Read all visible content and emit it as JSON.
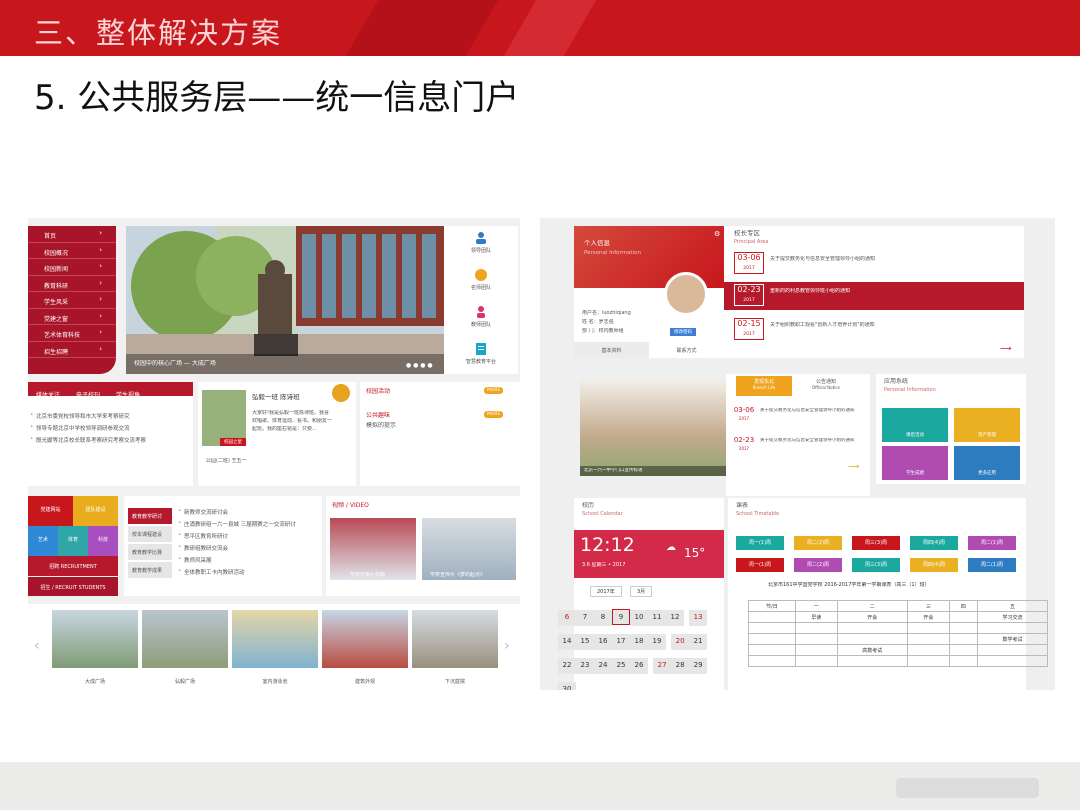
{
  "slide": {
    "header": "三、整体解决方案",
    "title": "5. 公共服务层——统一信息门户"
  },
  "left": {
    "menu": [
      "首页",
      "校园概况",
      "校园新闻",
      "教育科研",
      "学生风采",
      "党建之窗",
      "艺术体育科技",
      "招生招聘"
    ],
    "photo_caption": "校园中的核心广场 — 大成广场",
    "icons": [
      {
        "label": "领导团队",
        "icon": "people-icon"
      },
      {
        "label": "名师团队",
        "icon": "teacher-icon"
      },
      {
        "label": "教师团队",
        "icon": "person-icon"
      },
      {
        "label": "智慧教育平台",
        "icon": "book-icon"
      }
    ],
    "news_tabs": [
      "媒体关注",
      "电子校刊",
      "学生视角"
    ],
    "news_items": [
      "北京市委党校领导和市大学来考察研究",
      "领导专题北京中学校领导调研参观交流",
      "殷光媛等北京校长联系考察研究考察交流考察"
    ],
    "profile": {
      "name": "弘毅一班 陈诗班",
      "bio": [
        "大家好!我是弘毅一班陈诗班。我喜",
        "欢唱歌、体育运动、看书。和朋友一",
        "起玩。我的座右铭是：只要..."
      ],
      "badge": "校园之星",
      "footer": "公园(二班) 王五一"
    },
    "notice_title": "校园活动",
    "notice_tags": [
      "MORE",
      "MORE"
    ],
    "notice_items": [
      "公共趣味",
      "模拟的提示"
    ],
    "tiles": [
      {
        "label": "党建网站",
        "color": "#c8161d"
      },
      {
        "label": "团队建设",
        "color": "#e9ac1d"
      },
      {
        "label": "艺术",
        "color": "#2f89d6"
      },
      {
        "label": "体育",
        "color": "#30a6a8"
      },
      {
        "label": "科技",
        "color": "#a84fbf"
      }
    ],
    "recruit": [
      "招聘 RECRUITMENT",
      "招生 / RECRUIT STUDENTS"
    ],
    "sub_tabs": [
      "教育教学研讨",
      "校本课程建设",
      "教育教学比赛",
      "教育教学成果"
    ],
    "sub_items": [
      "新教师交流研讨会",
      "庄涌教研组一六一县城 三届期赛之一交流研讨",
      "思平区教育所研讨",
      "教研组教研交流会",
      "教师风采展",
      "全体教职工卡内教研活动"
    ],
    "video_title": "视频 / VIDEO",
    "video_caps": [
      "学校形象片剪辑",
      "学校宣传片《梦的起点》"
    ],
    "gallery": [
      "大成广场",
      "弘毅广场",
      "室内游泳池",
      "建筑外观",
      "下沉庭院"
    ]
  },
  "right": {
    "personal": {
      "title": "个人信息",
      "subtitle": "Personal Information",
      "fields": [
        "用户名：luozhiqiang",
        "姓  名：罗志强",
        "部  门：校内教师组"
      ],
      "tag": "修改密码",
      "tabs": [
        "基本资料",
        "联系方式"
      ]
    },
    "principal": {
      "title": "校长专区",
      "subtitle": "Principal Area",
      "items": [
        {
          "date": "03-06",
          "year": "2017",
          "text": "关于提交教务化与信息安全管理领导小组的通知"
        },
        {
          "date": "02-23",
          "year": "2017",
          "text": "重新的的利息教管领导班小组的通知"
        },
        {
          "date": "02-15",
          "year": "2017",
          "text": "关于组织教职工观看\"创新人才培养计划\"的通知"
        }
      ]
    },
    "photo_caption": "北京一六一中学门口宣传标语",
    "notice": {
      "tabs": [
        {
          "top": "发现东北",
          "sub": "Branch Life"
        },
        {
          "top": "公告通知",
          "sub": "Official Notice"
        }
      ],
      "items": [
        {
          "date": "03-06",
          "year": "2017",
          "text": "关于提交教务化与信息安全管理领导小组的通知"
        },
        {
          "date": "02-23",
          "year": "2017",
          "text": "关于提交教务化与信息安全管理领导小组的通知"
        }
      ]
    },
    "apps": {
      "title": "应用系统",
      "subtitle": "Personal Information",
      "items": [
        {
          "label": "课后活动",
          "color": "#1aa89f"
        },
        {
          "label": "资产管理",
          "color": "#eab021"
        },
        {
          "label": "学生成绩",
          "color": "#b04cb1"
        },
        {
          "label": "更多应用",
          "color": "#2d7cc0"
        }
      ]
    },
    "calendar": {
      "title": "校历",
      "subtitle": "School Calendar",
      "time": "12:12",
      "date": "3.6  星期三 • 2017",
      "temp": "15°",
      "year": "2017年",
      "month": "3月",
      "days": [
        "6",
        "7",
        "8",
        "9",
        "10",
        "11",
        "12",
        "13",
        "14",
        "15",
        "16",
        "17",
        "18",
        "19",
        "20",
        "21",
        "22",
        "23",
        "24",
        "25",
        "26",
        "27",
        "28",
        "29",
        "30"
      ]
    },
    "timetable": {
      "title": "课表",
      "subtitle": "School Timetable",
      "weeks": [
        "周一(1)周",
        "周二(2)周",
        "周三(3)周",
        "周四(4)周",
        "周二(1)周",
        "周一(1)周",
        "周二(2)周",
        "周三(3)周",
        "周四(4)周",
        "周二(1)周"
      ],
      "caption": "北京市161中学国党学校 2016-2017学年第一学期课表（高三（1）班）",
      "heads": [
        "节/日",
        "一",
        "二",
        "三",
        "四",
        "五"
      ],
      "cells": [
        "早读",
        "开会",
        "开会",
        "",
        "学习交流",
        "",
        "",
        "",
        "",
        "",
        "",
        "",
        "",
        "",
        "数学考试",
        "",
        "高数考试",
        "",
        "",
        ""
      ]
    }
  },
  "colors": {
    "accent": "#c8161d",
    "menu": "#a8152a"
  }
}
